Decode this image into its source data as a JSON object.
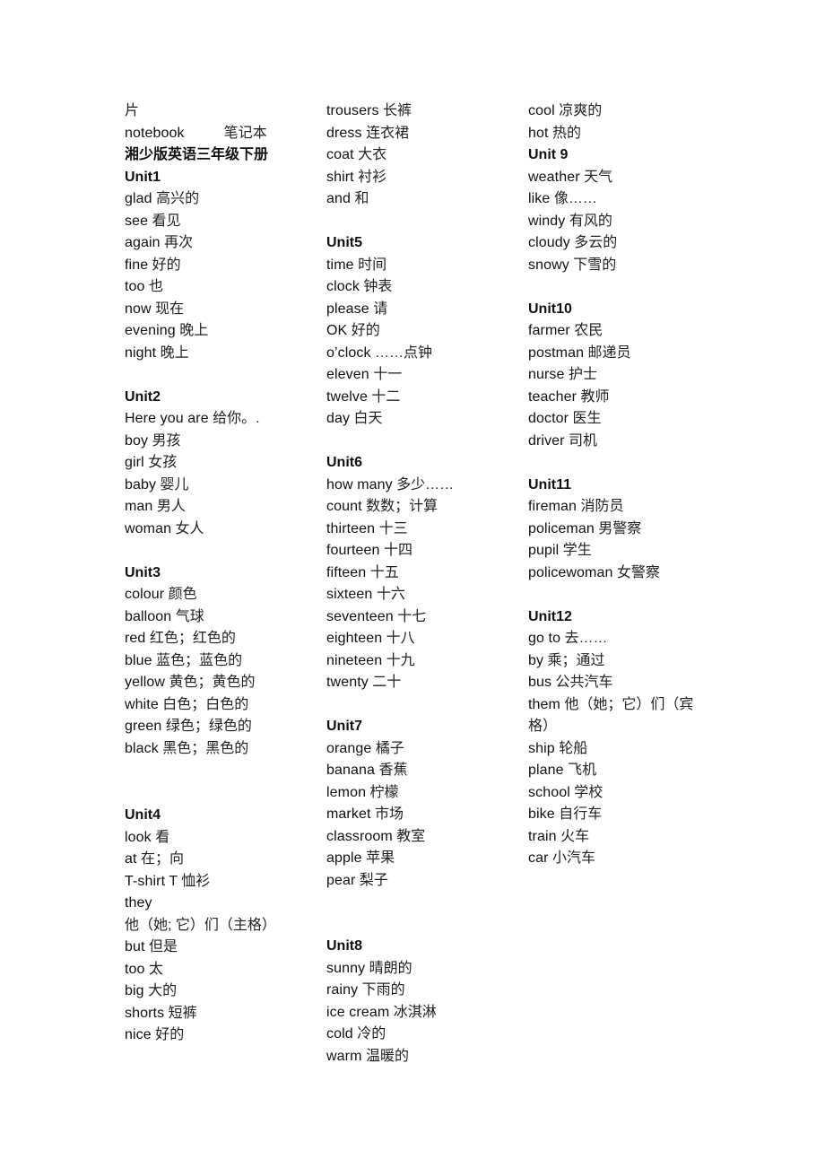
{
  "document": {
    "preface": {
      "fragment": "片",
      "notebook": {
        "en": "notebook",
        "zh": "笔记本"
      }
    },
    "title": "湘少版英语三年级下册",
    "units": [
      {
        "name": "Unit1",
        "words": [
          {
            "en": "glad",
            "zh": "高兴的"
          },
          {
            "en": "see",
            "zh": "看见"
          },
          {
            "en": "again",
            "zh": "再次"
          },
          {
            "en": "fine",
            "zh": "好的"
          },
          {
            "en": "too",
            "zh": "也"
          },
          {
            "en": "now",
            "zh": "现在"
          },
          {
            "en": "evening",
            "zh": "晚上"
          },
          {
            "en": "night",
            "zh": "晚上"
          }
        ]
      },
      {
        "name": "Unit2",
        "words": [
          {
            "en": "Here you are",
            "zh": " 给你。."
          },
          {
            "en": "boy",
            "zh": "男孩"
          },
          {
            "en": "girl",
            "zh": " 女孩"
          },
          {
            "en": "baby",
            "zh": " 婴儿"
          },
          {
            "en": "man",
            "zh": "男人"
          },
          {
            "en": "woman",
            "zh": "女人"
          }
        ]
      },
      {
        "name": "Unit3",
        "words": [
          {
            "en": "colour",
            "zh": "颜色"
          },
          {
            "en": "balloon",
            "zh": "气球"
          },
          {
            "en": "red",
            "zh": "红色；红色的"
          },
          {
            "en": "blue",
            "zh": "蓝色；蓝色的"
          },
          {
            "en": "yellow",
            "zh": "黄色；黄色的"
          },
          {
            "en": "white",
            "zh": "白色；白色的"
          },
          {
            "en": "green",
            "zh": "绿色；绿色的"
          },
          {
            "en": "black",
            "zh": "黑色；黑色的"
          }
        ]
      },
      {
        "name": "Unit4",
        "words": [
          {
            "en": "look",
            "zh": "看"
          },
          {
            "en": "at",
            "zh": "在；向"
          },
          {
            "en": "T-shirt",
            "zh": "T 恤衫"
          },
          {
            "en": "they",
            "zh": "他（她; 它）们（主格）"
          },
          {
            "en": "but",
            "zh": "但是"
          },
          {
            "en": "too",
            "zh": "太"
          },
          {
            "en": "big",
            "zh": "大的"
          },
          {
            "en": "shorts",
            "zh": "短裤"
          },
          {
            "en": "nice",
            "zh": "好的"
          },
          {
            "en": "trousers",
            "zh": "长裤"
          },
          {
            "en": "dress",
            "zh": "连衣裙"
          },
          {
            "en": "coat",
            "zh": "大衣"
          },
          {
            "en": "shirt",
            "zh": "衬衫"
          },
          {
            "en": "and",
            "zh": "和"
          }
        ]
      },
      {
        "name": "Unit5",
        "words": [
          {
            "en": "time",
            "zh": "时间"
          },
          {
            "en": "clock",
            "zh": "钟表"
          },
          {
            "en": "please",
            "zh": "请"
          },
          {
            "en": "OK",
            "zh": "好的"
          },
          {
            "en": "o’clock",
            "zh": "……点钟"
          },
          {
            "en": "eleven",
            "zh": "十一"
          },
          {
            "en": "twelve",
            "zh": "十二"
          },
          {
            "en": "day",
            "zh": "白天"
          }
        ]
      },
      {
        "name": "Unit6",
        "words": [
          {
            "en": "how many",
            "zh": "多少……"
          },
          {
            "en": "count",
            "zh": "数数；计算"
          },
          {
            "en": "thirteen",
            "zh": "十三"
          },
          {
            "en": "fourteen",
            "zh": "十四"
          },
          {
            "en": "fifteen",
            "zh": "十五"
          },
          {
            "en": "sixteen",
            "zh": "十六"
          },
          {
            "en": "seventeen",
            "zh": "十七"
          },
          {
            "en": "eighteen",
            "zh": "十八"
          },
          {
            "en": "nineteen",
            "zh": "十九"
          },
          {
            "en": "twenty",
            "zh": "二十"
          }
        ]
      },
      {
        "name": "Unit7",
        "words": [
          {
            "en": "orange",
            "zh": "橘子"
          },
          {
            "en": "banana",
            "zh": "香蕉"
          },
          {
            "en": "lemon",
            "zh": "柠檬"
          },
          {
            "en": "market",
            "zh": "市场"
          },
          {
            "en": "classroom",
            "zh": "教室"
          },
          {
            "en": "apple",
            "zh": "苹果"
          },
          {
            "en": "pear",
            "zh": "梨子"
          }
        ]
      },
      {
        "name": "Unit8",
        "words": [
          {
            "en": "sunny",
            "zh": "晴朗的"
          },
          {
            "en": "rainy",
            "zh": "下雨的"
          },
          {
            "en": "ice cream",
            "zh": "冰淇淋"
          },
          {
            "en": "cold",
            "zh": "冷的"
          },
          {
            "en": "warm",
            "zh": "温暖的"
          },
          {
            "en": "cool",
            "zh": "凉爽的"
          },
          {
            "en": "hot",
            "zh": "热的"
          }
        ]
      },
      {
        "name": "Unit 9",
        "words": [
          {
            "en": "weather",
            "zh": "天气"
          },
          {
            "en": "like",
            "zh": "像……"
          },
          {
            "en": "windy",
            "zh": "有风的"
          },
          {
            "en": "cloudy",
            "zh": "多云的"
          },
          {
            "en": "snowy",
            "zh": "下雪的"
          }
        ]
      },
      {
        "name": "Unit10",
        "words": [
          {
            "en": "farmer",
            "zh": "农民"
          },
          {
            "en": "postman",
            "zh": "邮递员"
          },
          {
            "en": "nurse",
            "zh": "护士"
          },
          {
            "en": "teacher",
            "zh": "教师"
          },
          {
            "en": "doctor",
            "zh": " 医生"
          },
          {
            "en": "driver",
            "zh": "司机"
          }
        ]
      },
      {
        "name": "Unit11",
        "words": [
          {
            "en": "fireman",
            "zh": "消防员"
          },
          {
            "en": "policeman",
            "zh": "男警察"
          },
          {
            "en": "pupil",
            "zh": "学生"
          },
          {
            "en": "policewoman",
            "zh": "女警察"
          }
        ]
      },
      {
        "name": "Unit12",
        "words": [
          {
            "en": "go to",
            "zh": " 去……"
          },
          {
            "en": "by",
            "zh": "乘；通过"
          },
          {
            "en": "bus",
            "zh": " 公共汽车"
          },
          {
            "en": "them",
            "zh": "他（她；它）们（宾格）"
          },
          {
            "en": "ship",
            "zh": "轮船"
          },
          {
            "en": "plane",
            "zh": "飞机"
          },
          {
            "en": "school",
            "zh": "学校"
          },
          {
            "en": "bike",
            "zh": " 自行车"
          },
          {
            "en": "train",
            "zh": "火车"
          },
          {
            "en": "car",
            "zh": "小汽车"
          }
        ]
      }
    ]
  }
}
